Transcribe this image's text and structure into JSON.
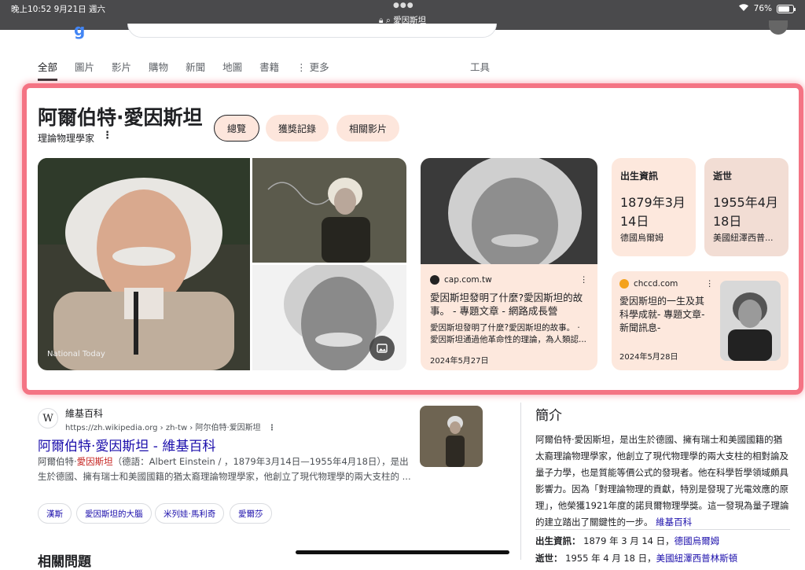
{
  "status_bar": {
    "time": "晚上10:52  9月21日 週六",
    "url": "愛因斯坦",
    "battery": "76%"
  },
  "tabs": [
    "全部",
    "圖片",
    "影片",
    "購物",
    "新聞",
    "地圖",
    "書籍",
    "⋮ 更多"
  ],
  "tools": "工具",
  "knowledge_panel": {
    "title": "阿爾伯特·愛因斯坦",
    "subtitle": "理論物理學家",
    "chips": [
      "總覽",
      "獲獎記錄",
      "相關影片"
    ],
    "image_caption": "National Today",
    "card1": {
      "source": "cap.com.tw",
      "title": "愛因斯坦發明了什麼?愛因斯坦的故事。 - 專題文章 - 網路成長營",
      "snippet": "愛因斯坦發明了什麼?愛因斯坦的故事。 · 愛因斯坦通過他革命性的理論，為人類認...",
      "date": "2024年5月27日"
    },
    "birth_card": {
      "label": "出生資訊",
      "value": "1879年3月14日",
      "place": "德國烏爾姆"
    },
    "death_card": {
      "label": "逝世",
      "value": "1955年4月18日",
      "place": "美國紐澤西普..."
    },
    "card2": {
      "source": "chccd.com",
      "title": "愛因斯坦的一生及其科學成就- 專題文章- 新聞訊息-",
      "date": "2024年5月28日"
    }
  },
  "result": {
    "site": "維基百科",
    "url": "https://zh.wikipedia.org › zh-tw › 阿尔伯特·爱因斯坦",
    "title": "阿爾伯特·愛因斯坦 - 維基百科",
    "snippet_pre": "阿爾伯特·",
    "snippet_em": "愛因斯坦",
    "snippet_post": "（德語：Albert Einstein / ，1879年3月14日—1955年4月18日），是出生於德國、擁有瑞士和美國國籍的猶太裔理論物理學家，他創立了現代物理學的兩大支柱的 ...",
    "pills": [
      "漢斯",
      "愛因斯坦的大腦",
      "米列娃·馬利奇",
      "愛爾莎"
    ]
  },
  "related_title": "相關問題",
  "intro": {
    "title": "簡介",
    "text": "阿爾伯特·愛因斯坦，是出生於德國、擁有瑞士和美國國籍的猶太裔理論物理學家，他創立了現代物理學的兩大支柱的相對論及量子力學，也是質能等價公式的發現者。他在科學哲學領域頗具影響力。因為「對理論物理的貢獻，特別是發現了光電效應的原理」，他榮獲1921年度的諾貝爾物理學獎。這一發現為量子理論的建立踏出了關鍵性的一步。",
    "source_link": "維基百科",
    "birth_label": "出生資訊：",
    "birth_value": "1879 年 3 月 14 日，",
    "birth_place": "德國烏爾姆",
    "death_label": "逝世：",
    "death_value": "1955 年 4 月 18 日，",
    "death_place": "美國紐澤西普林斯頓"
  }
}
